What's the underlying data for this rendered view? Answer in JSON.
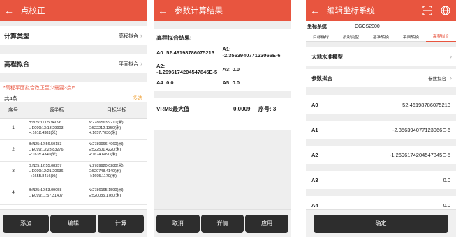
{
  "panel1": {
    "title": "点校正",
    "calc_type_label": "计算类型",
    "calc_type_value": "高程拟合",
    "elev_fit_label": "高程拟合",
    "elev_fit_value": "平面拟合",
    "hint": "*高程平面拟合改正至少需要3点!*",
    "count": "共4条",
    "multi_select": "多选",
    "headers": [
      "序号",
      "源坐标",
      "目标坐标"
    ],
    "rows": [
      {
        "idx": "1",
        "src": [
          "B:N25:11:05.94096",
          "L:E099:13:13.29903",
          "H:1618.4382(米)"
        ],
        "dst": [
          "N:2786563.9210(米)",
          "E:522212.1350(米)",
          "H:1657.7030(米)"
        ]
      },
      {
        "idx": "2",
        "src": [
          "B:N25:12:56.50183",
          "L:E099:13:23.83276",
          "H:1635.4340(米)"
        ],
        "dst": [
          "N:2789966.4960(米)",
          "E:522501.4220(米)",
          "H:1674.6890(米)"
        ]
      },
      {
        "idx": "3",
        "src": [
          "B:N25:12:55.08257",
          "L:E099:12:21.20636",
          "H:1655.8416(米)"
        ],
        "dst": [
          "N:2789920.0280(米)",
          "E:520748.4140(米)",
          "H:1695.1170(米)"
        ]
      },
      {
        "idx": "4",
        "src": [
          "B:N25:10:53.09058",
          "L:E099:11:57.31407",
          ""
        ],
        "dst": [
          "N:2786165.1590(米)",
          "E:520085.1760(米)",
          ""
        ]
      }
    ],
    "buttons": [
      "添加",
      "编辑",
      "计算"
    ]
  },
  "panel2": {
    "title": "参数计算结果",
    "sub": "高程拟合结果:",
    "a0": "A0: 52.46198786075213",
    "a1": "A1:\n-2.356394077123066E-6",
    "a2": "A2:\n-1.2696174204547845E-5",
    "a3": "A3: 0.0",
    "a4": "A4: 0.0",
    "a5": "A5: 0.0",
    "vrms_label": "VRMS最大值",
    "vrms_value": "0.0009",
    "vrms_seq": "序号: 3",
    "buttons": [
      "取消",
      "详情",
      "应用"
    ]
  },
  "panel3": {
    "title": "编辑坐标系统",
    "sys_label": "坐标系统",
    "sys_value": "CGCS2000",
    "tabs": [
      "目标椭球",
      "投影类型",
      "基准转换",
      "平面转换",
      "高程拟合"
    ],
    "geoid_label": "大地水准模型",
    "param_fit_label": "参数拟合",
    "param_fit_value": "参数拟合",
    "params": [
      {
        "k": "A0",
        "v": "52.46198786075213"
      },
      {
        "k": "A1",
        "v": "-2.356394077123066E-6"
      },
      {
        "k": "A2",
        "v": "-1.2696174204547845E-5"
      },
      {
        "k": "A3",
        "v": "0.0"
      },
      {
        "k": "A4",
        "v": "0.0"
      }
    ],
    "confirm": "确定"
  },
  "icons": {
    "back": "back-arrow-icon",
    "scan": "scan-icon",
    "globe": "globe-icon",
    "chevron": "chevron-right-icon"
  },
  "colors": {
    "accent": "#e8553f",
    "button": "#2d2d2d",
    "multi_select": "#f0a33a"
  }
}
